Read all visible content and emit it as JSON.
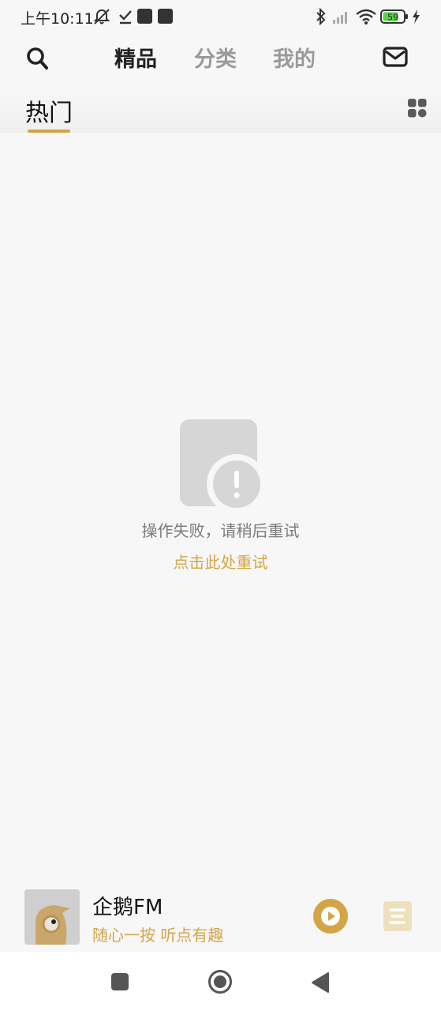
{
  "status_bar": {
    "time": "上午10:11",
    "battery_level": "59",
    "icons": [
      "mute-icon",
      "download-done-icon",
      "app-icon",
      "app-icon",
      "bluetooth-icon",
      "signal-icon",
      "wifi-icon",
      "battery-icon",
      "charging-icon"
    ]
  },
  "header": {
    "tabs": [
      {
        "label": "精品",
        "active": true
      },
      {
        "label": "分类",
        "active": false
      },
      {
        "label": "我的",
        "active": false
      }
    ],
    "left_icon": "search-icon",
    "right_icon": "mail-icon"
  },
  "subtabs": {
    "current": "热门",
    "right_icon": "grid-icon"
  },
  "error_state": {
    "icon": "load-error-icon",
    "message": "操作失败，请稍后重试",
    "retry_label": "点击此处重试"
  },
  "mini_player": {
    "title": "企鹅FM",
    "subtitle": "随心一按 听点有趣",
    "cover_icon": "penguin-logo-icon",
    "play_icon": "play-icon",
    "playlist_icon": "playlist-icon"
  },
  "nav_bar": {
    "buttons": [
      "recents-icon",
      "home-icon",
      "back-icon"
    ]
  },
  "colors": {
    "accent": "#d4a547",
    "background": "#f7f7f7",
    "text_primary": "#222222",
    "text_muted": "#9a9a9a"
  }
}
